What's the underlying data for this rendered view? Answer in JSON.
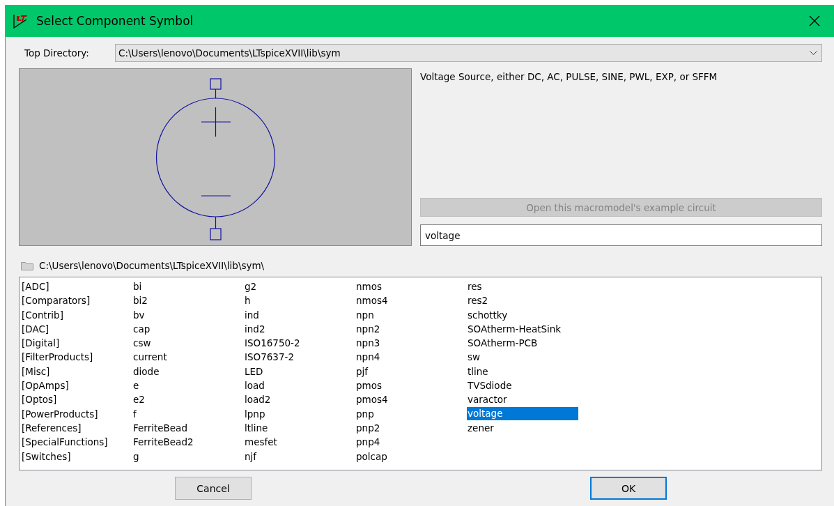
{
  "window": {
    "title": "Select Component Symbol"
  },
  "top_directory": {
    "label": "Top Directory:",
    "value": "C:\\Users\\lenovo\\Documents\\LTspiceXVII\\lib\\sym"
  },
  "description": "Voltage Source, either DC, AC, PULSE, SINE, PWL, EXP, or SFFM",
  "example_button": {
    "label": "Open this macromodel's example circuit",
    "disabled": true
  },
  "search": {
    "value": "voltage"
  },
  "current_path": "C:\\Users\\lenovo\\Documents\\LTspiceXVII\\lib\\sym\\",
  "symbols": [
    {
      "name": "[ADC]",
      "selected": false
    },
    {
      "name": "[Comparators]",
      "selected": false
    },
    {
      "name": "[Contrib]",
      "selected": false
    },
    {
      "name": "[DAC]",
      "selected": false
    },
    {
      "name": "[Digital]",
      "selected": false
    },
    {
      "name": "[FilterProducts]",
      "selected": false
    },
    {
      "name": "[Misc]",
      "selected": false
    },
    {
      "name": "[OpAmps]",
      "selected": false
    },
    {
      "name": "[Optos]",
      "selected": false
    },
    {
      "name": "[PowerProducts]",
      "selected": false
    },
    {
      "name": "[References]",
      "selected": false
    },
    {
      "name": "[SpecialFunctions]",
      "selected": false
    },
    {
      "name": "[Switches]",
      "selected": false
    },
    {
      "name": "bi",
      "selected": false
    },
    {
      "name": "bi2",
      "selected": false
    },
    {
      "name": "bv",
      "selected": false
    },
    {
      "name": "cap",
      "selected": false
    },
    {
      "name": "csw",
      "selected": false
    },
    {
      "name": "current",
      "selected": false
    },
    {
      "name": "diode",
      "selected": false
    },
    {
      "name": "e",
      "selected": false
    },
    {
      "name": "e2",
      "selected": false
    },
    {
      "name": "f",
      "selected": false
    },
    {
      "name": "FerriteBead",
      "selected": false
    },
    {
      "name": "FerriteBead2",
      "selected": false
    },
    {
      "name": "g",
      "selected": false
    },
    {
      "name": "g2",
      "selected": false
    },
    {
      "name": "h",
      "selected": false
    },
    {
      "name": "ind",
      "selected": false
    },
    {
      "name": "ind2",
      "selected": false
    },
    {
      "name": "ISO16750-2",
      "selected": false
    },
    {
      "name": "ISO7637-2",
      "selected": false
    },
    {
      "name": "LED",
      "selected": false
    },
    {
      "name": "load",
      "selected": false
    },
    {
      "name": "load2",
      "selected": false
    },
    {
      "name": "lpnp",
      "selected": false
    },
    {
      "name": "ltline",
      "selected": false
    },
    {
      "name": "mesfet",
      "selected": false
    },
    {
      "name": "njf",
      "selected": false
    },
    {
      "name": "nmos",
      "selected": false
    },
    {
      "name": "nmos4",
      "selected": false
    },
    {
      "name": "npn",
      "selected": false
    },
    {
      "name": "npn2",
      "selected": false
    },
    {
      "name": "npn3",
      "selected": false
    },
    {
      "name": "npn4",
      "selected": false
    },
    {
      "name": "pjf",
      "selected": false
    },
    {
      "name": "pmos",
      "selected": false
    },
    {
      "name": "pmos4",
      "selected": false
    },
    {
      "name": "pnp",
      "selected": false
    },
    {
      "name": "pnp2",
      "selected": false
    },
    {
      "name": "pnp4",
      "selected": false
    },
    {
      "name": "polcap",
      "selected": false
    },
    {
      "name": "res",
      "selected": false
    },
    {
      "name": "res2",
      "selected": false
    },
    {
      "name": "schottky",
      "selected": false
    },
    {
      "name": "SOAtherm-HeatSink",
      "selected": false
    },
    {
      "name": "SOAtherm-PCB",
      "selected": false
    },
    {
      "name": "sw",
      "selected": false
    },
    {
      "name": "tline",
      "selected": false
    },
    {
      "name": "TVSdiode",
      "selected": false
    },
    {
      "name": "varactor",
      "selected": false
    },
    {
      "name": "voltage",
      "selected": true
    },
    {
      "name": "zener",
      "selected": false
    }
  ],
  "buttons": [
    {
      "label": "Cancel",
      "kind": "cancel"
    },
    {
      "label": "OK",
      "kind": "default"
    }
  ]
}
